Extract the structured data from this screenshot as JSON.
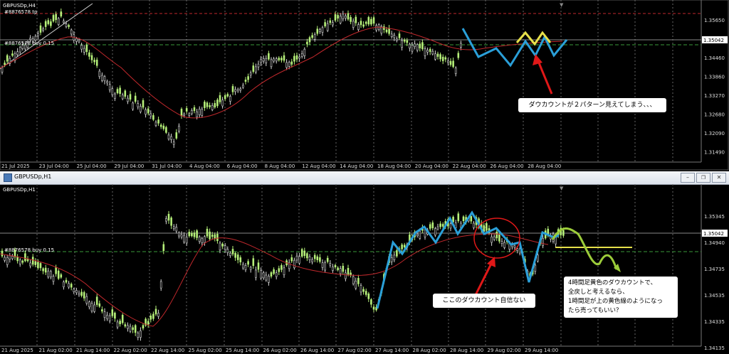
{
  "top": {
    "title": "GBPUSDp,H4",
    "tp_label": "#8876578 tp",
    "buy_label": "#8876578  buy 0.15",
    "price_tag": "1.35042",
    "price_ticks": [
      "1.35650",
      "1.35050",
      "1.34460",
      "1.33860",
      "1.33270",
      "1.32680",
      "1.32090",
      "1.31490"
    ],
    "time_ticks": [
      "21 Jul 2025",
      "23 Jul 04:00",
      "25 Jul 04:00",
      "29 Jul 04:00",
      "31 Jul 04:00",
      "4 Aug 04:00",
      "6 Aug 04:00",
      "8 Aug 04:00",
      "12 Aug 04:00",
      "14 Aug 04:00",
      "18 Aug 04:00",
      "20 Aug 04:00",
      "22 Aug 04:00",
      "26 Aug 04:00",
      "28 Aug 04:00"
    ],
    "annotation": "ダウカウントが２パターン見えてしまう、、、"
  },
  "bottom": {
    "window_title": "GBPUSDp,H1",
    "subtitle": "GBPUSDp,H1",
    "buy_label": "#8876578  buy 0.15",
    "price_tag": "1.35042",
    "price_ticks": [
      "1.35345",
      "1.34940",
      "1.34735",
      "1.34535",
      "1.34335",
      "1.34135"
    ],
    "time_ticks": [
      "21 Aug 2025",
      "21 Aug 02:00",
      "21 Aug 14:00",
      "22 Aug 02:00",
      "22 Aug 14:00",
      "25 Aug 02:00",
      "25 Aug 14:00",
      "26 Aug 02:00",
      "26 Aug 14:00",
      "27 Aug 02:00",
      "27 Aug 14:00",
      "28 Aug 02:00",
      "28 Aug 14:00",
      "29 Aug 02:00",
      "29 Aug 14:00"
    ],
    "annotation_left": "ここのダウカウント自信ない",
    "annotation_right": [
      "4時間足黄色のダウカウントで、",
      "全戻しと考えるなら、",
      "1時間足が上の黄色線のようになっ",
      "たら売ってもいい？"
    ]
  },
  "colors": {
    "bull": "#b6f07a",
    "bear": "#e8f5d8",
    "ma": "#c0282c",
    "blue": "#2a9fd8",
    "yellow": "#e6e04a",
    "green": "#9ccc3a",
    "red_arrow": "#e01818"
  }
}
